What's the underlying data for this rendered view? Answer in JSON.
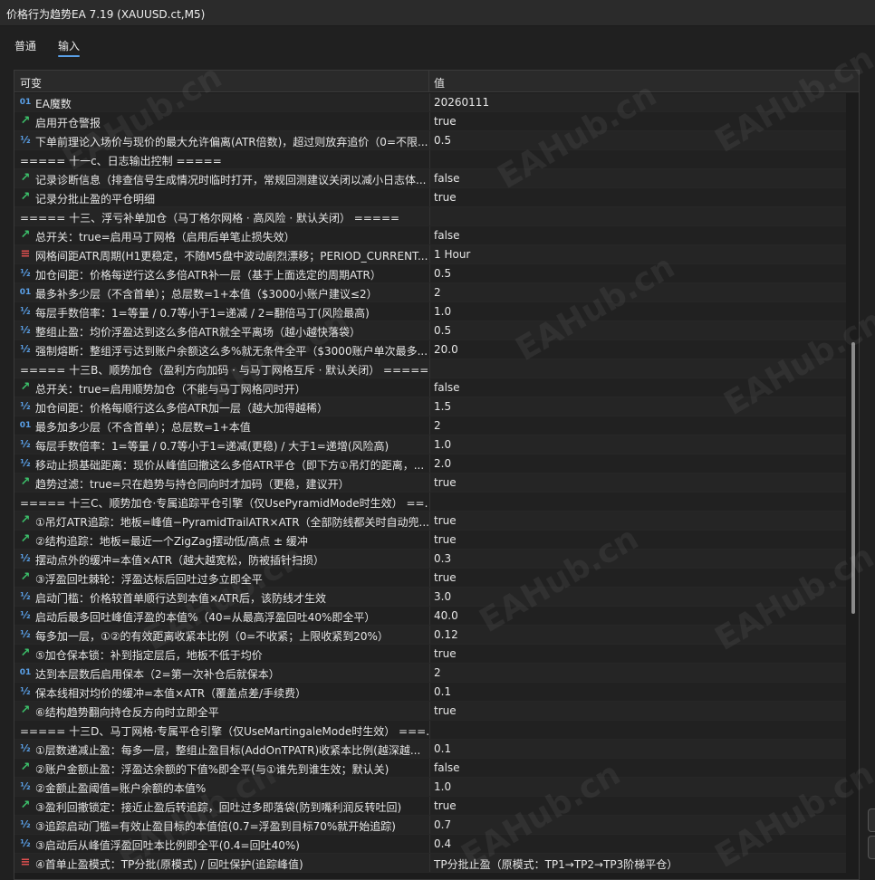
{
  "window": {
    "title": "价格行为趋势EA 7.19 (XAUUSD.ct,M5)"
  },
  "tabs": [
    {
      "label": "普通"
    },
    {
      "label": "输入"
    }
  ],
  "table": {
    "col_name": "可变",
    "col_value": "值",
    "rows": [
      {
        "icon": "01",
        "type": "num",
        "name": "EA魔数",
        "value": "20260111"
      },
      {
        "icon": "↗",
        "type": "bool",
        "name": "启用开仓警报",
        "value": "true"
      },
      {
        "icon": "½",
        "type": "frac",
        "name": "下单前理论入场价与现价的最大允许偏离(ATR倍数)，超过则放弃追价（0=不限...",
        "value": "0.5"
      },
      {
        "icon": "",
        "type": "section",
        "name": "===== 十一c、日志输出控制 =====",
        "value": ""
      },
      {
        "icon": "↗",
        "type": "bool",
        "name": "记录诊断信息（排查信号生成情况时临时打开，常规回测建议关闭以减小日志体...",
        "value": "false"
      },
      {
        "icon": "↗",
        "type": "bool",
        "name": "记录分批止盈的平仓明细",
        "value": "true"
      },
      {
        "icon": "",
        "type": "section",
        "name": "===== 十三、浮亏补单加仓（马丁格尔网格 · 高风险 · 默认关闭） =====",
        "value": ""
      },
      {
        "icon": "↗",
        "type": "bool",
        "name": "总开关：true=启用马丁网格（启用后单笔止损失效）",
        "value": "false"
      },
      {
        "icon": "≡",
        "type": "list",
        "name": "网格间距ATR周期(H1更稳定，不随M5盘中波动剧烈漂移；PERIOD_CURRENT...",
        "value": "1 Hour"
      },
      {
        "icon": "½",
        "type": "frac",
        "name": "加仓间距：价格每逆行这么多倍ATR补一层（基于上面选定的周期ATR）",
        "value": "0.5"
      },
      {
        "icon": "01",
        "type": "num",
        "name": "最多补多少层（不含首单）；总层数=1+本值（$3000小账户建议≤2）",
        "value": "2"
      },
      {
        "icon": "½",
        "type": "frac",
        "name": "每层手数倍率：1=等量 / 0.7等小于1=递减 / 2=翻倍马丁(风险最高)",
        "value": "1.0"
      },
      {
        "icon": "½",
        "type": "frac",
        "name": "整组止盈：均价浮盈达到这么多倍ATR就全平离场（越小越快落袋）",
        "value": "0.5"
      },
      {
        "icon": "½",
        "type": "frac",
        "name": "强制熔断：整组浮亏达到账户余额这么多%就无条件全平（$3000账户单次最多...",
        "value": "20.0"
      },
      {
        "icon": "",
        "type": "section",
        "name": "===== 十三B、顺势加仓（盈利方向加码 · 与马丁网格互斥 · 默认关闭） =====",
        "value": ""
      },
      {
        "icon": "↗",
        "type": "bool",
        "name": "总开关：true=启用顺势加仓（不能与马丁网格同时开）",
        "value": "false"
      },
      {
        "icon": "½",
        "type": "frac",
        "name": "加仓间距：价格每顺行这么多倍ATR加一层（越大加得越稀）",
        "value": "1.5"
      },
      {
        "icon": "01",
        "type": "num",
        "name": "最多加多少层（不含首单）；总层数=1+本值",
        "value": "2"
      },
      {
        "icon": "½",
        "type": "frac",
        "name": "每层手数倍率：1=等量 / 0.7等小于1=递减(更稳) / 大于1=递增(风险高)",
        "value": "1.0"
      },
      {
        "icon": "½",
        "type": "frac",
        "name": "移动止损基础距离：现价从峰值回撤这么多倍ATR平仓（即下方①吊灯的距离，...",
        "value": "2.0"
      },
      {
        "icon": "↗",
        "type": "bool",
        "name": "趋势过滤：true=只在趋势与持仓同向时才加码（更稳，建议开）",
        "value": "true"
      },
      {
        "icon": "",
        "type": "section",
        "name": "===== 十三C、顺势加仓·专属追踪平仓引擎（仅UsePyramidMode时生效） ==...",
        "value": ""
      },
      {
        "icon": "↗",
        "type": "bool",
        "name": "①吊灯ATR追踪：地板=峰值−PyramidTrailATR×ATR（全部防线都关时自动兜...",
        "value": "true"
      },
      {
        "icon": "↗",
        "type": "bool",
        "name": "②结构追踪：地板=最近一个ZigZag摆动低/高点 ± 缓冲",
        "value": "true"
      },
      {
        "icon": "½",
        "type": "frac",
        "name": "摆动点外的缓冲=本值×ATR（越大越宽松，防被插针扫损）",
        "value": "0.3"
      },
      {
        "icon": "↗",
        "type": "bool",
        "name": "③浮盈回吐棘轮：浮盈达标后回吐过多立即全平",
        "value": "true"
      },
      {
        "icon": "½",
        "type": "frac",
        "name": "启动门槛：价格较首单顺行达到本值×ATR后，该防线才生效",
        "value": "3.0"
      },
      {
        "icon": "½",
        "type": "frac",
        "name": "启动后最多回吐峰值浮盈的本值%（40=从最高浮盈回吐40%即全平）",
        "value": "40.0"
      },
      {
        "icon": "½",
        "type": "frac",
        "name": "每多加一层，①②的有效距离收紧本比例（0=不收紧；上限收紧到20%）",
        "value": "0.12"
      },
      {
        "icon": "↗",
        "type": "bool",
        "name": "⑤加仓保本锁：补到指定层后，地板不低于均价",
        "value": "true"
      },
      {
        "icon": "01",
        "type": "num",
        "name": "达到本层数后启用保本（2=第一次补仓后就保本）",
        "value": "2"
      },
      {
        "icon": "½",
        "type": "frac",
        "name": "保本线相对均价的缓冲=本值×ATR（覆盖点差/手续费）",
        "value": "0.1"
      },
      {
        "icon": "↗",
        "type": "bool",
        "name": "⑥结构趋势翻向持仓反方向时立即全平",
        "value": "true"
      },
      {
        "icon": "",
        "type": "section",
        "name": "===== 十三D、马丁网格·专属平仓引擎（仅UseMartingaleMode时生效） ===...",
        "value": ""
      },
      {
        "icon": "½",
        "type": "frac",
        "name": "①层数递减止盈：每多一层，整组止盈目标(AddOnTPATR)收紧本比例(越深越...",
        "value": "0.1"
      },
      {
        "icon": "↗",
        "type": "bool",
        "name": "②账户金额止盈：浮盈达余额的下值%即全平(与①谁先到谁生效；默认关)",
        "value": "false"
      },
      {
        "icon": "½",
        "type": "frac",
        "name": "②金额止盈阈值=账户余额的本值%",
        "value": "1.0"
      },
      {
        "icon": "↗",
        "type": "bool",
        "name": "③盈利回撤锁定：接近止盈后转追踪，回吐过多即落袋(防到嘴利润反转吐回)",
        "value": "true"
      },
      {
        "icon": "½",
        "type": "frac",
        "name": "③追踪启动门槛=有效止盈目标的本值倍(0.7=浮盈到目标70%就开始追踪)",
        "value": "0.7"
      },
      {
        "icon": "½",
        "type": "frac",
        "name": "③启动后从峰值浮盈回吐本比例即全平(0.4=回吐40%)",
        "value": "0.4"
      },
      {
        "icon": "≡",
        "type": "list",
        "name": "④首单止盈模式：TP分批(原模式) / 回吐保护(追踪峰值)",
        "value": "TP分批止盈（原模式：TP1→TP2→TP3阶梯平仓）"
      }
    ]
  },
  "watermark": "EAHub.cn"
}
